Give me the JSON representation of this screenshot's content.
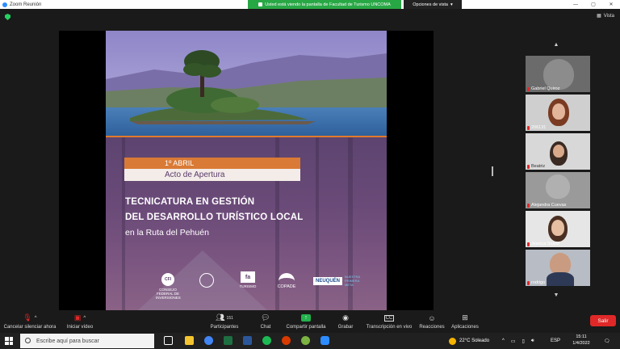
{
  "window": {
    "title": "Zoom Reunión",
    "share_banner": "Usted está viendo la pantalla de Facultad de Turismo UNCOMA",
    "view_options": "Opciones de vista",
    "view_label": "Vista"
  },
  "slide": {
    "date": "1º ABRIL",
    "event": "Acto de Apertura",
    "title_line1": "TECNICATURA EN GESTIÓN",
    "title_line2": "DEL DESARROLLO TURÍSTICO LOCAL",
    "subtitle": "en la Ruta del Pehuén",
    "logos": [
      {
        "mark": "CFI",
        "caption": "CONSEJO FEDERAL DE INVERSIONES"
      },
      {
        "mark": "",
        "caption": ""
      },
      {
        "mark": "fa",
        "caption": "TURISMO"
      },
      {
        "mark": "",
        "caption": "COPADE"
      },
      {
        "mark": "NEUQUÉN",
        "caption": "NUESTRA PRIMERA META"
      }
    ]
  },
  "participants": [
    {
      "name": "Gabriel Quiroz"
    },
    {
      "name": "206131"
    },
    {
      "name": "Beatriz"
    },
    {
      "name": "Alejandra Cuevas"
    },
    {
      "name": "Jessica Scarel"
    },
    {
      "name": "rodrigo"
    }
  ],
  "toolbar": {
    "mute": "Cancelar silenciar ahora",
    "video": "Iniciar vídeo",
    "participants": "Participantes",
    "participants_count": "151",
    "chat": "Chat",
    "share": "Compartir pantalla",
    "record": "Grabar",
    "transcript": "Transcripción en vivo",
    "reactions": "Reacciones",
    "apps": "Aplicaciones",
    "leave": "Salir"
  },
  "taskbar": {
    "search_placeholder": "Escribe aquí para buscar",
    "weather": "22°C  Soleado",
    "lang": "ESP",
    "time": "15:11",
    "date": "1/4/2022"
  }
}
